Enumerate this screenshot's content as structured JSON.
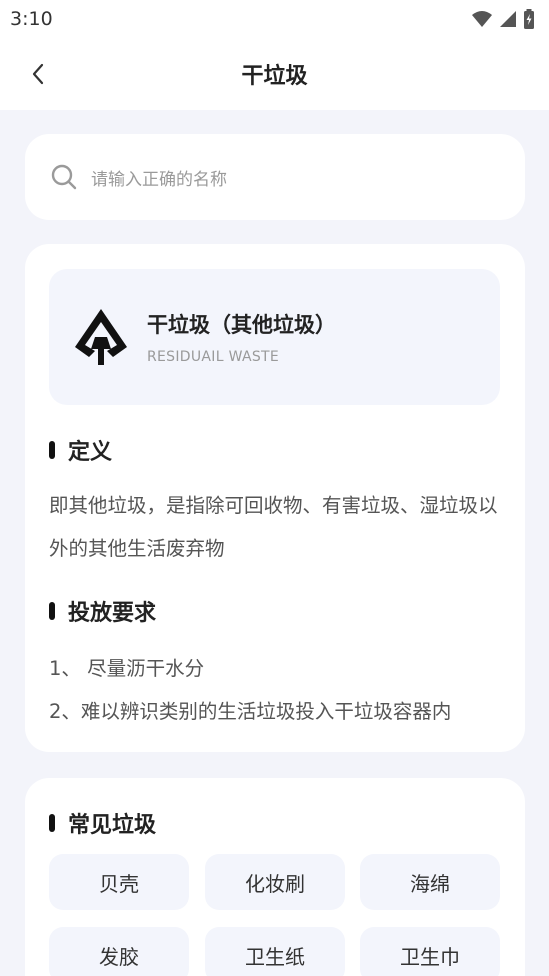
{
  "status_bar": {
    "time": "3:10"
  },
  "nav": {
    "title": "干垃圾"
  },
  "search": {
    "placeholder": "请输入正确的名称"
  },
  "category": {
    "title": "干垃圾（其他垃圾）",
    "subtitle": "RESIDUAIL WASTE"
  },
  "definition": {
    "heading": "定义",
    "text": "即其他垃圾，是指除可回收物、有害垃圾、湿垃圾以外的其他生活废弃物"
  },
  "requirements": {
    "heading": "投放要求",
    "items": [
      "1、 尽量沥干水分",
      "2、难以辨识类别的生活垃圾投入干垃圾容器内"
    ]
  },
  "common": {
    "heading": "常见垃圾",
    "items": [
      "贝壳",
      "化妆刷",
      "海绵",
      "发胶",
      "卫生纸",
      "卫生巾"
    ]
  },
  "colors": {
    "accent": "#111111",
    "chip_bg": "#F3F5FC",
    "page_bg": "#F3F4FA"
  }
}
